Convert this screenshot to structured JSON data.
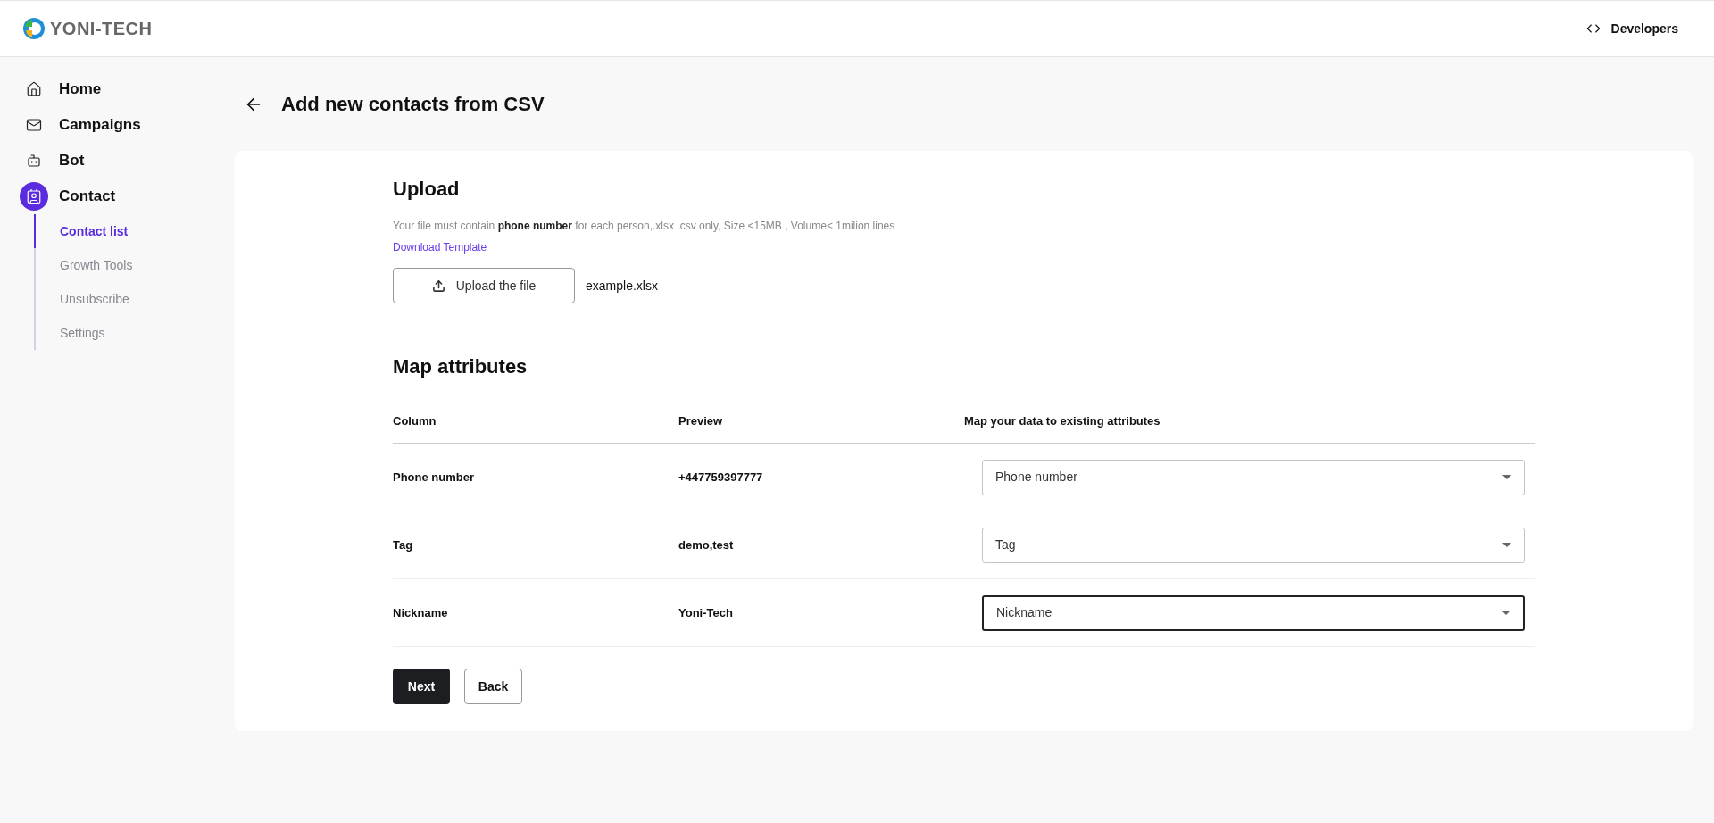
{
  "header": {
    "logo": "YONI-TECH",
    "developers": "Developers"
  },
  "sidebar": {
    "items": [
      {
        "label": "Home",
        "selected": false
      },
      {
        "label": "Campaigns",
        "selected": false
      },
      {
        "label": "Bot",
        "selected": false
      },
      {
        "label": "Contact",
        "selected": true,
        "children": [
          {
            "label": "Contact list",
            "selected": true
          },
          {
            "label": "Growth Tools",
            "selected": false
          },
          {
            "label": "Unsubscribe",
            "selected": false
          },
          {
            "label": "Settings",
            "selected": false
          }
        ]
      }
    ]
  },
  "page": {
    "title": "Add new contacts from CSV"
  },
  "upload": {
    "title": "Upload",
    "hint": "Your file must contain **phone number** for each person,.xlsx .csv only, Size <15MB , Volume< 1milion lines",
    "template_link": "Download Template",
    "button": "Upload the file",
    "file_name": "example.xlsx"
  },
  "map": {
    "title": "Map attributes",
    "columns": [
      "Column",
      "Preview",
      "Map your data to existing attributes"
    ],
    "rows": [
      {
        "column": "Phone number",
        "preview": "+447759397777",
        "attribute": "Phone number",
        "focused": false
      },
      {
        "column": "Tag",
        "preview": "demo,test",
        "attribute": "Tag",
        "focused": false
      },
      {
        "column": "Nickname",
        "preview": "Yoni-Tech",
        "attribute": "Nickname",
        "focused": true
      }
    ]
  },
  "buttons": {
    "next": "Next",
    "back": "Back"
  }
}
